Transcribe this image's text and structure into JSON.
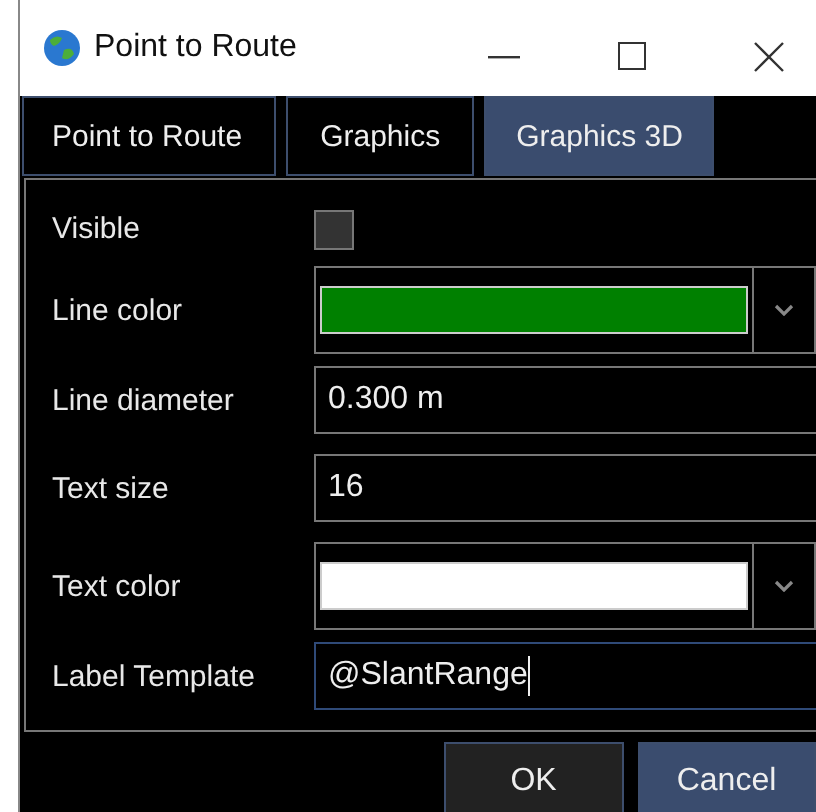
{
  "window": {
    "title": "Point to Route"
  },
  "tabs": [
    {
      "label": "Point to Route",
      "selected": false
    },
    {
      "label": "Graphics",
      "selected": false
    },
    {
      "label": "Graphics 3D",
      "selected": true
    }
  ],
  "fields": [
    {
      "kind": "checkbox",
      "label": "Visible",
      "checked": false
    },
    {
      "kind": "color",
      "label": "Line color",
      "color": "#008000"
    },
    {
      "kind": "text",
      "label": "Line diameter",
      "value": "0.300 m",
      "focused": false
    },
    {
      "kind": "text",
      "label": "Text size",
      "value": "16",
      "focused": false
    },
    {
      "kind": "color",
      "label": "Text color",
      "color": "#ffffff"
    },
    {
      "kind": "text",
      "label": "Label Template",
      "value": "@SlantRange",
      "focused": true
    }
  ],
  "buttons": [
    {
      "label": "OK",
      "default": false
    },
    {
      "label": "Cancel",
      "default": true
    }
  ]
}
